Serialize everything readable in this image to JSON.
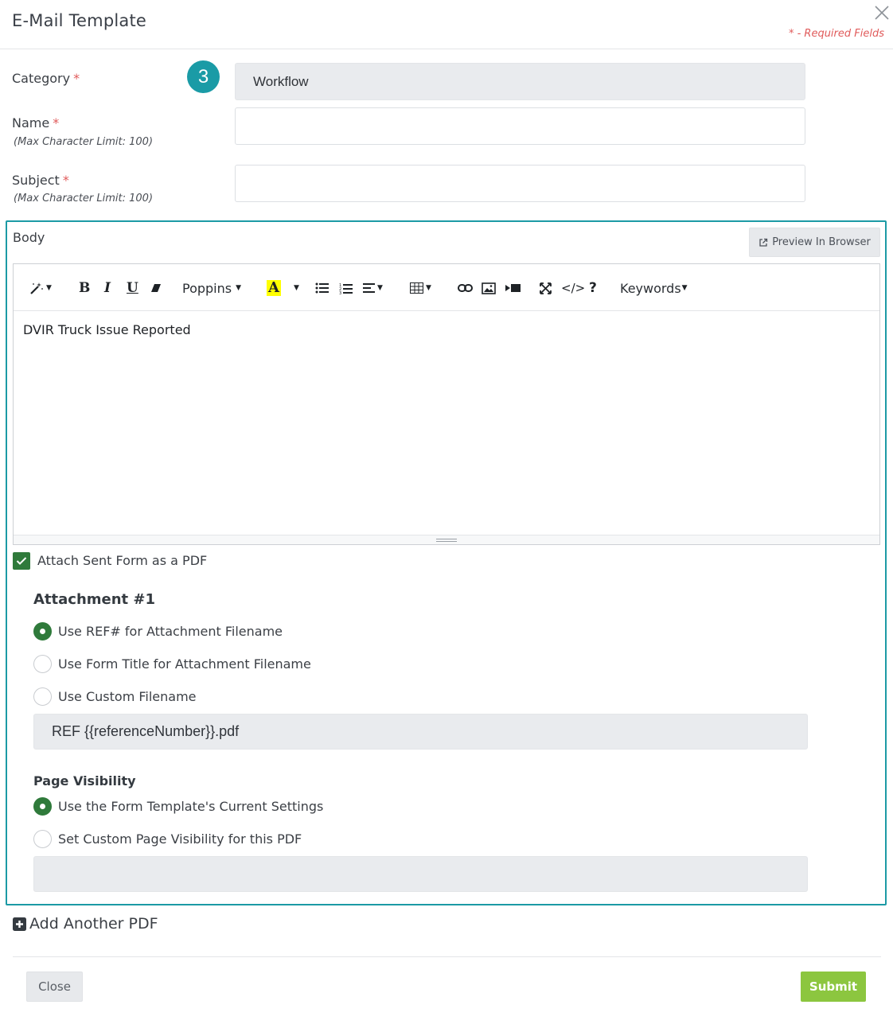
{
  "header": {
    "title": "E-Mail Template",
    "required_note": "* - Required Fields"
  },
  "form": {
    "category": {
      "label": "Category",
      "required_mark": "*",
      "value": "Workflow",
      "step_badge": "3"
    },
    "name": {
      "label": "Name",
      "required_mark": "*",
      "hint": "(Max Character Limit: 100)",
      "value": ""
    },
    "subject": {
      "label": "Subject",
      "required_mark": "*",
      "hint": "(Max Character Limit: 100)",
      "value": ""
    }
  },
  "body": {
    "label": "Body",
    "preview_button": "Preview In Browser",
    "toolbar": {
      "font": "Poppins",
      "keywords": "Keywords"
    },
    "content": "DVIR Truck Issue Reported"
  },
  "attach": {
    "checkbox_label": "Attach Sent Form as a PDF",
    "checked": true,
    "attachment_title": "Attachment #1",
    "filename_options": [
      {
        "label": "Use REF# for Attachment Filename",
        "selected": true
      },
      {
        "label": "Use Form Title for Attachment Filename",
        "selected": false
      },
      {
        "label": "Use Custom Filename",
        "selected": false
      }
    ],
    "filename_value": "REF {{referenceNumber}}.pdf",
    "page_visibility_title": "Page Visibility",
    "visibility_options": [
      {
        "label": "Use the Form Template's Current Settings",
        "selected": true
      },
      {
        "label": "Set Custom Page Visibility for this PDF",
        "selected": false
      }
    ],
    "visibility_value": ""
  },
  "add_pdf_label": "Add Another PDF",
  "footer": {
    "close_label": "Close",
    "submit_label": "Submit"
  },
  "colors": {
    "teal": "#1a9ba6",
    "green": "#2f7a3b",
    "submit": "#8cc63f",
    "required": "#e05a5a"
  }
}
